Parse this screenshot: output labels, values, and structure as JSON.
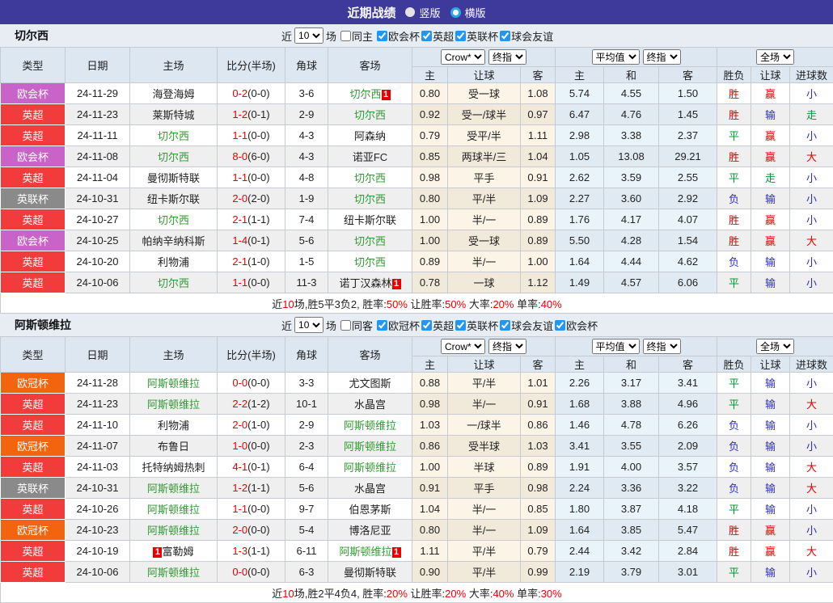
{
  "topbar": {
    "title": "近期战绩",
    "radios": [
      {
        "label": "竖版",
        "selected": false
      },
      {
        "label": "横版",
        "selected": true
      }
    ]
  },
  "table_header": {
    "cols": [
      "类型",
      "日期",
      "主场",
      "比分(半场)",
      "角球",
      "客场"
    ],
    "odds_sub": [
      "主",
      "让球",
      "客"
    ],
    "avg_sub": [
      "主",
      "和",
      "客"
    ],
    "result_sub": [
      "胜负",
      "让球",
      "进球数"
    ],
    "selects": {
      "bookmaker": "Crow*",
      "final": "终指",
      "average": "平均值",
      "final2": "终指",
      "scope": "全场"
    }
  },
  "filter_labels": {
    "near": "近",
    "matches": "场"
  },
  "league_colors": {
    "欧会杯": "#c963c9",
    "英超": "#f23b3b",
    "英联杯": "#8a8a8a",
    "欧冠杯": "#f2640e"
  },
  "result_colors": {
    "胜": "#e60000",
    "赢": "#e60000",
    "大": "#e60000",
    "平": "#009933",
    "走": "#009933",
    "负": "#2d2dcc",
    "输": "#2d2dcc",
    "小": "#2d2dcc"
  },
  "sections": [
    {
      "team": "切尔西",
      "filter": {
        "count": "10",
        "same": "同主",
        "same_checked": false,
        "leagues": [
          "欧会杯",
          "英超",
          "英联杯",
          "球会友谊"
        ]
      },
      "rows": [
        {
          "league": "欧会杯",
          "date": "24-11-29",
          "home": "海登海姆",
          "home_focus": false,
          "home_card": false,
          "score": "0-2",
          "half": "(0-0)",
          "corners": "3-6",
          "away": "切尔西",
          "away_focus": true,
          "away_card": true,
          "odds": [
            "0.80",
            "受一球",
            "1.08"
          ],
          "avg": [
            "5.74",
            "4.55",
            "1.50"
          ],
          "results": [
            "胜",
            "赢",
            "小"
          ]
        },
        {
          "league": "英超",
          "date": "24-11-23",
          "home": "莱斯特城",
          "home_focus": false,
          "home_card": false,
          "score": "1-2",
          "half": "(0-1)",
          "corners": "2-9",
          "away": "切尔西",
          "away_focus": true,
          "away_card": false,
          "odds": [
            "0.92",
            "受一/球半",
            "0.97"
          ],
          "avg": [
            "6.47",
            "4.76",
            "1.45"
          ],
          "results": [
            "胜",
            "输",
            "走"
          ]
        },
        {
          "league": "英超",
          "date": "24-11-11",
          "home": "切尔西",
          "home_focus": true,
          "home_card": false,
          "score": "1-1",
          "half": "(0-0)",
          "corners": "4-3",
          "away": "阿森纳",
          "away_focus": false,
          "away_card": false,
          "odds": [
            "0.79",
            "受平/半",
            "1.11"
          ],
          "avg": [
            "2.98",
            "3.38",
            "2.37"
          ],
          "results": [
            "平",
            "赢",
            "小"
          ]
        },
        {
          "league": "欧会杯",
          "date": "24-11-08",
          "home": "切尔西",
          "home_focus": true,
          "home_card": false,
          "score": "8-0",
          "half": "(6-0)",
          "corners": "4-3",
          "away": "诺亚FC",
          "away_focus": false,
          "away_card": false,
          "odds": [
            "0.85",
            "两球半/三",
            "1.04"
          ],
          "avg": [
            "1.05",
            "13.08",
            "29.21"
          ],
          "results": [
            "胜",
            "赢",
            "大"
          ]
        },
        {
          "league": "英超",
          "date": "24-11-04",
          "home": "曼彻斯特联",
          "home_focus": false,
          "home_card": false,
          "score": "1-1",
          "half": "(0-0)",
          "corners": "4-8",
          "away": "切尔西",
          "away_focus": true,
          "away_card": false,
          "odds": [
            "0.98",
            "平手",
            "0.91"
          ],
          "avg": [
            "2.62",
            "3.59",
            "2.55"
          ],
          "results": [
            "平",
            "走",
            "小"
          ]
        },
        {
          "league": "英联杯",
          "date": "24-10-31",
          "home": "纽卡斯尔联",
          "home_focus": false,
          "home_card": false,
          "score": "2-0",
          "half": "(2-0)",
          "corners": "1-9",
          "away": "切尔西",
          "away_focus": true,
          "away_card": false,
          "odds": [
            "0.80",
            "平/半",
            "1.09"
          ],
          "avg": [
            "2.27",
            "3.60",
            "2.92"
          ],
          "results": [
            "负",
            "输",
            "小"
          ]
        },
        {
          "league": "英超",
          "date": "24-10-27",
          "home": "切尔西",
          "home_focus": true,
          "home_card": false,
          "score": "2-1",
          "half": "(1-1)",
          "corners": "7-4",
          "away": "纽卡斯尔联",
          "away_focus": false,
          "away_card": false,
          "odds": [
            "1.00",
            "半/一",
            "0.89"
          ],
          "avg": [
            "1.76",
            "4.17",
            "4.07"
          ],
          "results": [
            "胜",
            "赢",
            "小"
          ]
        },
        {
          "league": "欧会杯",
          "date": "24-10-25",
          "home": "帕纳辛纳科斯",
          "home_focus": false,
          "home_card": false,
          "score": "1-4",
          "half": "(0-1)",
          "corners": "5-6",
          "away": "切尔西",
          "away_focus": true,
          "away_card": false,
          "odds": [
            "1.00",
            "受一球",
            "0.89"
          ],
          "avg": [
            "5.50",
            "4.28",
            "1.54"
          ],
          "results": [
            "胜",
            "赢",
            "大"
          ]
        },
        {
          "league": "英超",
          "date": "24-10-20",
          "home": "利物浦",
          "home_focus": false,
          "home_card": false,
          "score": "2-1",
          "half": "(1-0)",
          "corners": "1-5",
          "away": "切尔西",
          "away_focus": true,
          "away_card": false,
          "odds": [
            "0.89",
            "半/一",
            "1.00"
          ],
          "avg": [
            "1.64",
            "4.44",
            "4.62"
          ],
          "results": [
            "负",
            "输",
            "小"
          ]
        },
        {
          "league": "英超",
          "date": "24-10-06",
          "home": "切尔西",
          "home_focus": true,
          "home_card": false,
          "score": "1-1",
          "half": "(0-0)",
          "corners": "11-3",
          "away": "诺丁汉森林",
          "away_focus": false,
          "away_card": true,
          "odds": [
            "0.78",
            "一球",
            "1.12"
          ],
          "avg": [
            "1.49",
            "4.57",
            "6.06"
          ],
          "results": [
            "平",
            "输",
            "小"
          ]
        }
      ],
      "summary": [
        {
          "t": "近"
        },
        {
          "t": "10",
          "red": true
        },
        {
          "t": "场,胜5平3负2, 胜率:"
        },
        {
          "t": "50%",
          "red": true
        },
        {
          "t": " 让胜率:"
        },
        {
          "t": "50%",
          "red": true
        },
        {
          "t": " 大率:"
        },
        {
          "t": "20%",
          "red": true
        },
        {
          "t": " 单率:"
        },
        {
          "t": "40%",
          "red": true
        }
      ]
    },
    {
      "team": "阿斯顿维拉",
      "filter": {
        "count": "10",
        "same": "同客",
        "same_checked": false,
        "leagues": [
          "欧冠杯",
          "英超",
          "英联杯",
          "球会友谊",
          "欧会杯"
        ]
      },
      "rows": [
        {
          "league": "欧冠杯",
          "date": "24-11-28",
          "home": "阿斯顿维拉",
          "home_focus": true,
          "home_card": false,
          "score": "0-0",
          "half": "(0-0)",
          "corners": "3-3",
          "away": "尤文图斯",
          "away_focus": false,
          "away_card": false,
          "odds": [
            "0.88",
            "平/半",
            "1.01"
          ],
          "avg": [
            "2.26",
            "3.17",
            "3.41"
          ],
          "results": [
            "平",
            "输",
            "小"
          ]
        },
        {
          "league": "英超",
          "date": "24-11-23",
          "home": "阿斯顿维拉",
          "home_focus": true,
          "home_card": false,
          "score": "2-2",
          "half": "(1-2)",
          "corners": "10-1",
          "away": "水晶宫",
          "away_focus": false,
          "away_card": false,
          "odds": [
            "0.98",
            "半/一",
            "0.91"
          ],
          "avg": [
            "1.68",
            "3.88",
            "4.96"
          ],
          "results": [
            "平",
            "输",
            "大"
          ]
        },
        {
          "league": "英超",
          "date": "24-11-10",
          "home": "利物浦",
          "home_focus": false,
          "home_card": false,
          "score": "2-0",
          "half": "(1-0)",
          "corners": "2-9",
          "away": "阿斯顿维拉",
          "away_focus": true,
          "away_card": false,
          "odds": [
            "1.03",
            "一/球半",
            "0.86"
          ],
          "avg": [
            "1.46",
            "4.78",
            "6.26"
          ],
          "results": [
            "负",
            "输",
            "小"
          ]
        },
        {
          "league": "欧冠杯",
          "date": "24-11-07",
          "home": "布鲁日",
          "home_focus": false,
          "home_card": false,
          "score": "1-0",
          "half": "(0-0)",
          "corners": "2-3",
          "away": "阿斯顿维拉",
          "away_focus": true,
          "away_card": false,
          "odds": [
            "0.86",
            "受半球",
            "1.03"
          ],
          "avg": [
            "3.41",
            "3.55",
            "2.09"
          ],
          "results": [
            "负",
            "输",
            "小"
          ]
        },
        {
          "league": "英超",
          "date": "24-11-03",
          "home": "托特纳姆热刺",
          "home_focus": false,
          "home_card": false,
          "score": "4-1",
          "half": "(0-1)",
          "corners": "6-4",
          "away": "阿斯顿维拉",
          "away_focus": true,
          "away_card": false,
          "odds": [
            "1.00",
            "半球",
            "0.89"
          ],
          "avg": [
            "1.91",
            "4.00",
            "3.57"
          ],
          "results": [
            "负",
            "输",
            "大"
          ]
        },
        {
          "league": "英联杯",
          "date": "24-10-31",
          "home": "阿斯顿维拉",
          "home_focus": true,
          "home_card": false,
          "score": "1-2",
          "half": "(1-1)",
          "corners": "5-6",
          "away": "水晶宫",
          "away_focus": false,
          "away_card": false,
          "odds": [
            "0.91",
            "平手",
            "0.98"
          ],
          "avg": [
            "2.24",
            "3.36",
            "3.22"
          ],
          "results": [
            "负",
            "输",
            "大"
          ]
        },
        {
          "league": "英超",
          "date": "24-10-26",
          "home": "阿斯顿维拉",
          "home_focus": true,
          "home_card": false,
          "score": "1-1",
          "half": "(0-0)",
          "corners": "9-7",
          "away": "伯恩茅斯",
          "away_focus": false,
          "away_card": false,
          "odds": [
            "1.04",
            "半/一",
            "0.85"
          ],
          "avg": [
            "1.80",
            "3.87",
            "4.18"
          ],
          "results": [
            "平",
            "输",
            "小"
          ]
        },
        {
          "league": "欧冠杯",
          "date": "24-10-23",
          "home": "阿斯顿维拉",
          "home_focus": true,
          "home_card": false,
          "score": "2-0",
          "half": "(0-0)",
          "corners": "5-4",
          "away": "博洛尼亚",
          "away_focus": false,
          "away_card": false,
          "odds": [
            "0.80",
            "半/一",
            "1.09"
          ],
          "avg": [
            "1.64",
            "3.85",
            "5.47"
          ],
          "results": [
            "胜",
            "赢",
            "小"
          ]
        },
        {
          "league": "英超",
          "date": "24-10-19",
          "home": "富勒姆",
          "home_focus": false,
          "home_card": true,
          "score": "1-3",
          "half": "(1-1)",
          "corners": "6-11",
          "away": "阿斯顿维拉",
          "away_focus": true,
          "away_card": true,
          "odds": [
            "1.11",
            "平/半",
            "0.79"
          ],
          "avg": [
            "2.44",
            "3.42",
            "2.84"
          ],
          "results": [
            "胜",
            "赢",
            "大"
          ]
        },
        {
          "league": "英超",
          "date": "24-10-06",
          "home": "阿斯顿维拉",
          "home_focus": true,
          "home_card": false,
          "score": "0-0",
          "half": "(0-0)",
          "corners": "6-3",
          "away": "曼彻斯特联",
          "away_focus": false,
          "away_card": false,
          "odds": [
            "0.90",
            "平/半",
            "0.99"
          ],
          "avg": [
            "2.19",
            "3.79",
            "3.01"
          ],
          "results": [
            "平",
            "输",
            "小"
          ]
        }
      ],
      "summary": [
        {
          "t": "近"
        },
        {
          "t": "10",
          "red": true
        },
        {
          "t": "场,胜2平4负4, 胜率:"
        },
        {
          "t": "20%",
          "red": true
        },
        {
          "t": " 让胜率:"
        },
        {
          "t": "20%",
          "red": true
        },
        {
          "t": " 大率:"
        },
        {
          "t": "40%",
          "red": true
        },
        {
          "t": " 单率:"
        },
        {
          "t": "30%",
          "red": true
        }
      ]
    }
  ]
}
